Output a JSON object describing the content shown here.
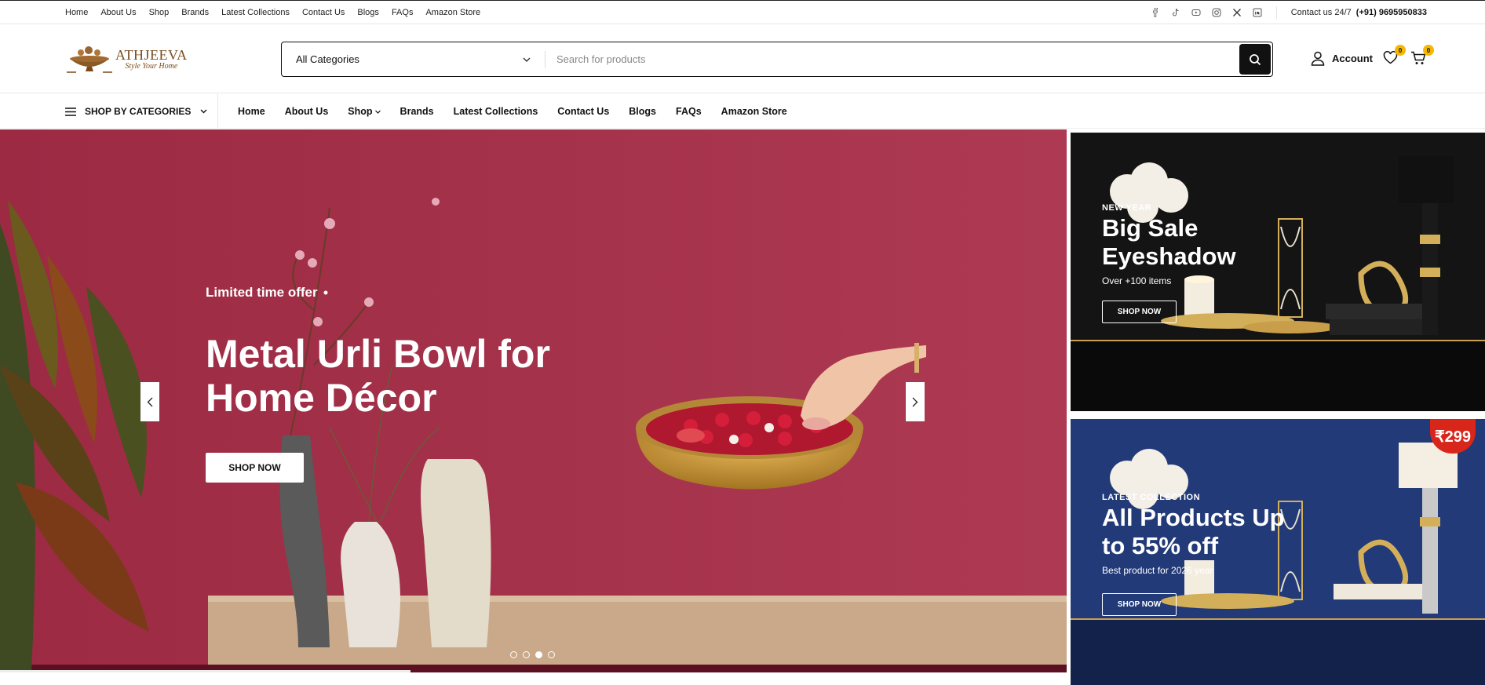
{
  "topbar": {
    "nav": [
      "Home",
      "About Us",
      "Shop",
      "Brands",
      "Latest Collections",
      "Contact Us",
      "Blogs",
      "FAQs",
      "Amazon Store"
    ],
    "social_icons": [
      "facebook-icon",
      "tiktok-icon",
      "youtube-icon",
      "instagram-icon",
      "x-icon",
      "linkedin-icon"
    ],
    "contact_label": "Contact us 24/7",
    "contact_phone": "(+91) 9695950833"
  },
  "header": {
    "logo_name": "ATHJEEVA",
    "logo_tagline": "Style Your Home",
    "category_select": "All Categories",
    "search_placeholder": "Search for products",
    "account_label": "Account",
    "wishlist_count": "0",
    "cart_count": "0"
  },
  "navbar": {
    "shop_by_categories": "SHOP BY CATEGORIES",
    "items": [
      "Home",
      "About Us",
      "Shop",
      "Brands",
      "Latest Collections",
      "Contact Us",
      "Blogs",
      "FAQs",
      "Amazon Store"
    ]
  },
  "hero": {
    "offer": "Limited time offer",
    "title": "Metal Urli Bowl for Home Décor",
    "button": "SHOP NOW",
    "slide_count": 4,
    "active_slide": 3
  },
  "promos": [
    {
      "eyebrow": "NEW YEAR",
      "title": "Big Sale Eyeshadow",
      "subtitle": "Over +100 items",
      "button": "SHOP NOW"
    },
    {
      "eyebrow": "LATEST COLLECTION",
      "title": "All Products Up to 55% off",
      "subtitle": "Best product for 2026 year",
      "button": "SHOP NOW",
      "price_tag": "₹299"
    }
  ],
  "colors": {
    "hero_bg": "#a3304a",
    "badge": "#f5b800",
    "price_tag": "#d8261b",
    "promo2_bg": "#223a78"
  }
}
